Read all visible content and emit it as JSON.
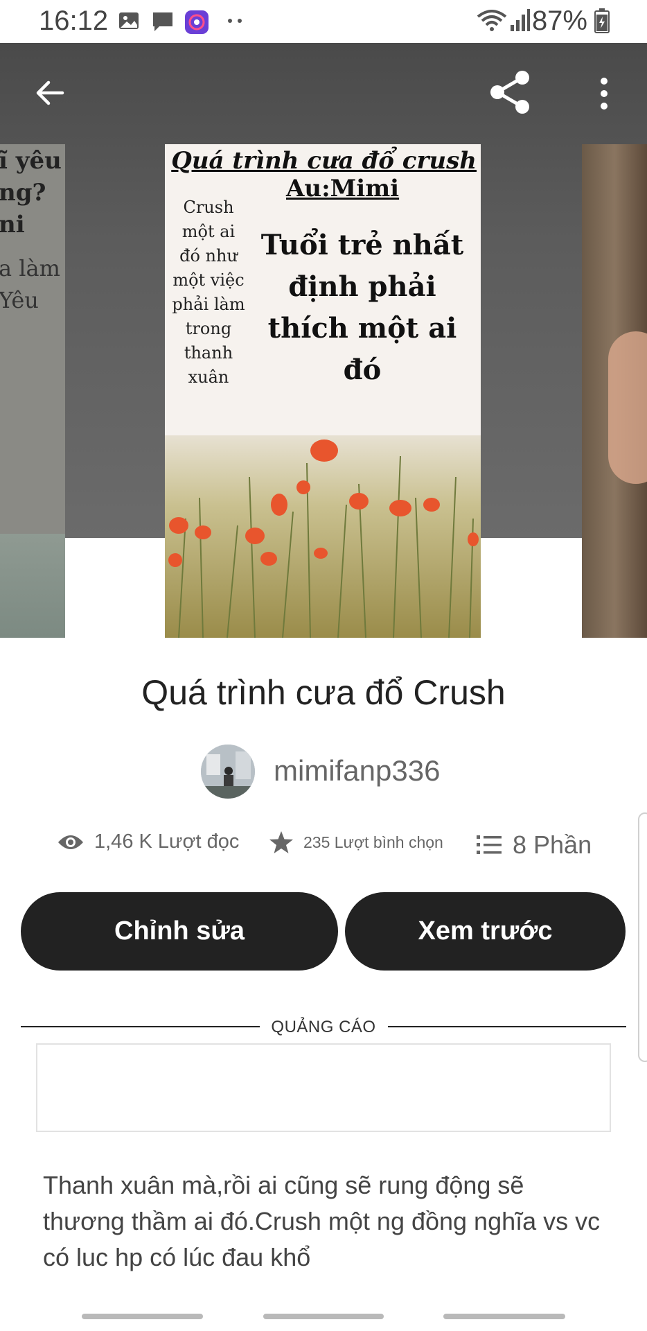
{
  "status_bar": {
    "time": "16:12",
    "battery": "87%",
    "icons": [
      "gallery-icon",
      "message-icon",
      "app-notification-icon",
      "more-dots-icon",
      "wifi-icon",
      "signal-icon",
      "battery-icon"
    ]
  },
  "top_bar": {
    "icons": [
      "back-arrow-icon",
      "share-icon",
      "more-vertical-icon"
    ]
  },
  "cover": {
    "title_text": "Quá trình cưa đổ crush",
    "author_text": "Au:Mimi",
    "left_text": "Crush một ai đó như một việc phải làm trong thanh xuân",
    "main_text": "Tuổi trẻ nhất định phải thích một ai đó"
  },
  "left_cover": {
    "lines": [
      "ĩ yêu",
      "ng?",
      "ni",
      "a làm",
      "Yêu"
    ]
  },
  "story": {
    "title": "Quá trình cưa đổ Crush",
    "author": "mimifanp336"
  },
  "stats": {
    "reads": "1,46 K Lượt đọc",
    "votes": "235 Lượt bình chọn",
    "parts": "8 Phần"
  },
  "buttons": {
    "edit": "Chỉnh sửa",
    "preview": "Xem trước"
  },
  "ad": {
    "label": "QUẢNG CÁO"
  },
  "description": "Thanh xuân mà,rồi ai cũng sẽ rung động sẽ thương thầm ai đó.Crush một ng đồng nghĩa vs vc có luc hp có lúc đau khổ",
  "colors": {
    "button_bg": "#222222",
    "button_text": "#ffffff",
    "accent_poppy": "#e8552d"
  }
}
